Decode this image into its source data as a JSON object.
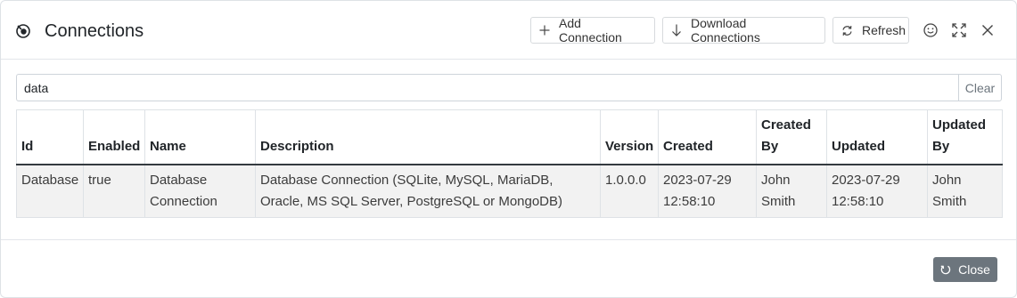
{
  "dialog": {
    "title": "Connections",
    "title_icon": "plug-icon",
    "buttons": {
      "add": "Add Connection",
      "download": "Download Connections",
      "refresh": "Refresh"
    },
    "window_icons": [
      "smiley-icon",
      "expand-icon",
      "close-icon"
    ]
  },
  "search": {
    "value": "data",
    "clear_label": "Clear"
  },
  "table": {
    "headers": {
      "id": "Id",
      "enabled": "Enabled",
      "name": "Name",
      "description": "Description",
      "version": "Version",
      "created": "Created",
      "created_by": "Created By",
      "updated": "Updated",
      "updated_by": "Updated By"
    },
    "rows": [
      {
        "id": "Database",
        "enabled": "true",
        "name": "Database Connection",
        "description": "Database Connection (SQLite, MySQL, MariaDB, Oracle, MS SQL Server, PostgreSQL or MongoDB)",
        "version": "1.0.0.0",
        "created": "2023-07-29 12:58:10",
        "created_by": "John Smith",
        "updated": "2023-07-29 12:58:10",
        "updated_by": "John Smith"
      }
    ]
  },
  "footer": {
    "close_label": "Close"
  },
  "colors": {
    "close_button_bg": "#6c757d",
    "row_bg": "#f2f2f2",
    "header_rule": "#343a40"
  }
}
